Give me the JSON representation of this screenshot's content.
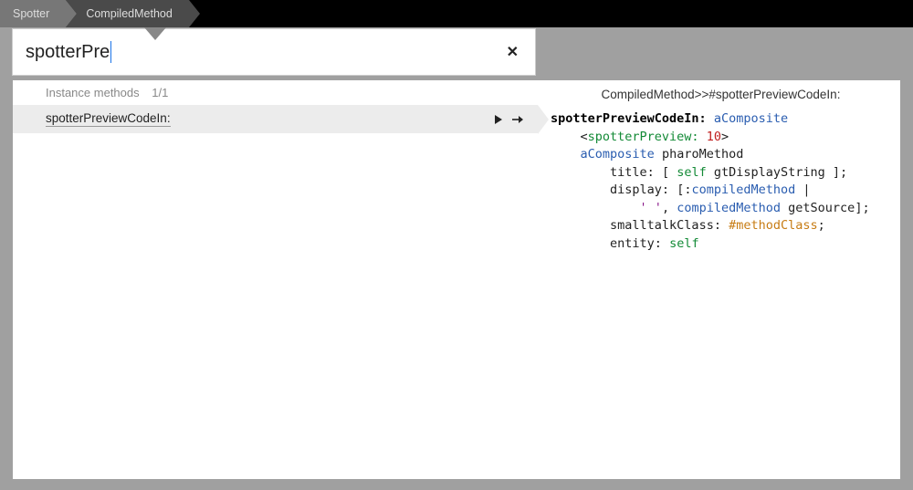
{
  "breadcrumbs": {
    "first": "Spotter",
    "second": "CompiledMethod"
  },
  "search": {
    "query": "spotterPre",
    "close_label": "✕"
  },
  "section": {
    "title": "Instance methods",
    "count": "1/1"
  },
  "result": {
    "name": "spotterPreviewCodeIn:"
  },
  "preview": {
    "title": "CompiledMethod>>#spotterPreviewCodeIn:"
  },
  "code": {
    "sel": "spotterPreviewCodeIn:",
    "arg": "aComposite",
    "pragma_key": "spotterPreview:",
    "pragma_num": "10",
    "recv": "aComposite",
    "msg1": "pharoMethod",
    "k_title": "title:",
    "self1": "self",
    "m_gtDisplay": "gtDisplayString",
    "k_display": "display:",
    "block_arg": "compiledMethod",
    "str_lit": "' '",
    "comma": ",",
    "m_getSource": "getSource",
    "k_smallClass": "smalltalkClass:",
    "sym_methodClass": "#methodClass",
    "k_entity": "entity:",
    "self2": "self"
  }
}
